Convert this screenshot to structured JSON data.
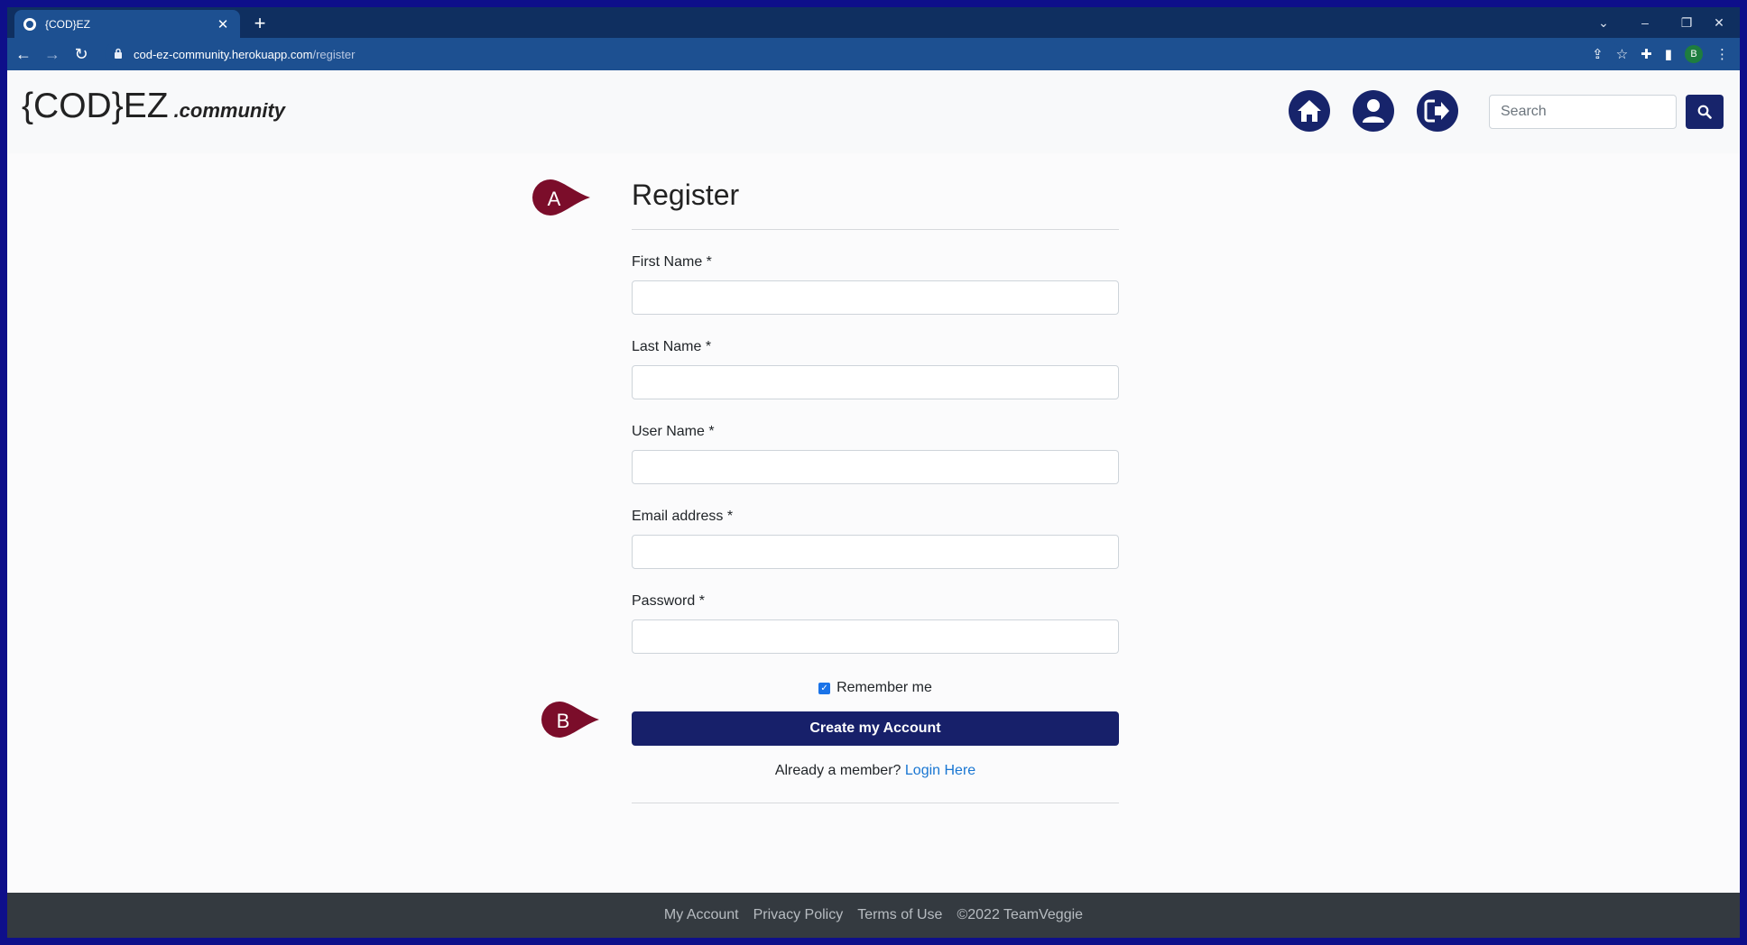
{
  "browser": {
    "tab_title": "{COD}EZ",
    "tab_close": "✕",
    "new_tab": "+",
    "url_host": "cod-ez-community.herokuapp.com",
    "url_path": "/register",
    "profile_initial": "B"
  },
  "navbar": {
    "brand_main": "{COD}EZ",
    "brand_sub": ".community",
    "search_placeholder": "Search"
  },
  "form": {
    "title": "Register",
    "fields": [
      {
        "label": "First Name *"
      },
      {
        "label": "Last Name *"
      },
      {
        "label": "User Name *"
      },
      {
        "label": "Email address *"
      },
      {
        "label": "Password *"
      }
    ],
    "remember_label": "Remember me",
    "remember_checked": true,
    "submit_label": "Create my Account",
    "already_text": "Already a member?",
    "login_link": "Login Here"
  },
  "markers": {
    "a": "A",
    "b": "B",
    "color": "#7b0d2a"
  },
  "footer": {
    "links": [
      "My Account",
      "Privacy Policy",
      "Terms of Use",
      "©2022 TeamVeggie"
    ]
  },
  "colors": {
    "primary": "#17206a",
    "link": "#1976d2",
    "footer_bg": "#343a40"
  }
}
